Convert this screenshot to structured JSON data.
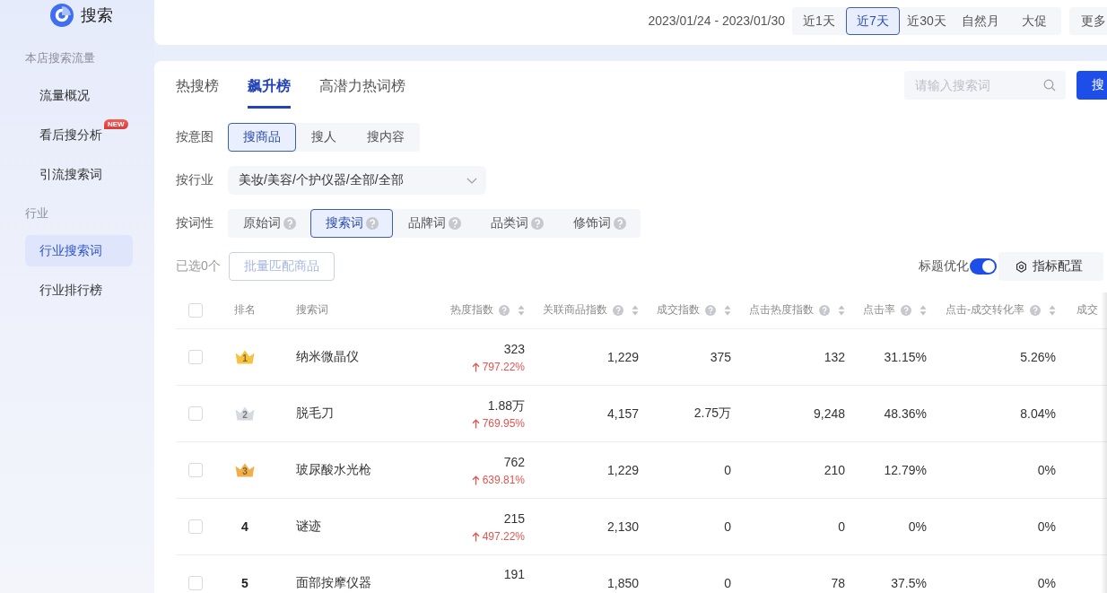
{
  "sidebar": {
    "title": "搜索",
    "sections": [
      {
        "heading": "本店搜索流量",
        "items": [
          {
            "label": "流量概况",
            "selected": false
          },
          {
            "label": "看后搜分析",
            "selected": false,
            "badge": "NEW"
          },
          {
            "label": "引流搜索词",
            "selected": false
          }
        ]
      },
      {
        "heading": "行业",
        "items": [
          {
            "label": "行业搜索词",
            "selected": true
          },
          {
            "label": "行业排行榜",
            "selected": false
          }
        ]
      }
    ]
  },
  "top_bar": {
    "date_range": "2023/01/24 - 2023/01/30",
    "periods": [
      {
        "label": "近1天",
        "selected": false
      },
      {
        "label": "近7天",
        "selected": true
      },
      {
        "label": "近30天",
        "selected": false
      },
      {
        "label": "自然月",
        "selected": false
      },
      {
        "label": "大促",
        "selected": false
      }
    ],
    "more_button": "更多"
  },
  "tabs": [
    {
      "label": "热搜榜",
      "selected": false
    },
    {
      "label": "飙升榜",
      "selected": true
    },
    {
      "label": "高潜力热词榜",
      "selected": false
    }
  ],
  "search": {
    "placeholder": "请输入搜索词",
    "button": "搜"
  },
  "filters": {
    "intent": {
      "label": "按意图",
      "options": [
        {
          "label": "搜商品",
          "selected": true
        },
        {
          "label": "搜人",
          "selected": false
        },
        {
          "label": "搜内容",
          "selected": false
        }
      ]
    },
    "industry": {
      "label": "按行业",
      "value": "美妆/美容/个护仪器/全部/全部"
    },
    "word_type": {
      "label": "按词性",
      "options": [
        {
          "label": "原始词",
          "selected": false
        },
        {
          "label": "搜索词",
          "selected": true
        },
        {
          "label": "品牌词",
          "selected": false
        },
        {
          "label": "品类词",
          "selected": false
        },
        {
          "label": "修饰词",
          "selected": false
        }
      ]
    }
  },
  "selection": {
    "label": "已选0个",
    "batch_button": {
      "label": "批量匹配商品",
      "disabled": true
    }
  },
  "title_optimize": {
    "label": "标题优化",
    "on": true
  },
  "metric_config_button": "指标配置",
  "table": {
    "header_checked": false,
    "columns": [
      {
        "label": "排名",
        "kind": "rank"
      },
      {
        "label": "搜索词",
        "kind": "keyword"
      },
      {
        "label": "热度指数",
        "kind": "metric"
      },
      {
        "label": "关联商品指数",
        "kind": "metric"
      },
      {
        "label": "成交指数",
        "kind": "metric"
      },
      {
        "label": "点击热度指数",
        "kind": "metric"
      },
      {
        "label": "点击率",
        "kind": "metric"
      },
      {
        "label": "点击-成交转化率",
        "kind": "metric"
      },
      {
        "label": "成交",
        "kind": "plain"
      }
    ],
    "rows": [
      {
        "checked": false,
        "rank": {
          "kind": "crown",
          "text": "1",
          "color": "#f5c342"
        },
        "keyword": "纳米微晶仪",
        "metrics": [
          {
            "value": "323",
            "change": "797.22%"
          },
          {
            "value": "1,229"
          },
          {
            "value": "375"
          },
          {
            "value": "132"
          },
          {
            "value": "31.15%"
          },
          {
            "value": "5.26%"
          }
        ]
      },
      {
        "checked": false,
        "rank": {
          "kind": "crown",
          "text": "2",
          "color": "#d6d9de"
        },
        "keyword": "脱毛刀",
        "metrics": [
          {
            "value": "1.88万",
            "change": "769.95%"
          },
          {
            "value": "4,157"
          },
          {
            "value": "2.75万"
          },
          {
            "value": "9,248"
          },
          {
            "value": "48.36%"
          },
          {
            "value": "8.04%"
          }
        ]
      },
      {
        "checked": false,
        "rank": {
          "kind": "crown",
          "text": "3",
          "color": "#efb04c"
        },
        "keyword": "玻尿酸水光枪",
        "metrics": [
          {
            "value": "762",
            "change": "639.81%"
          },
          {
            "value": "1,229"
          },
          {
            "value": "0"
          },
          {
            "value": "210"
          },
          {
            "value": "12.79%"
          },
          {
            "value": "0%"
          }
        ]
      },
      {
        "checked": false,
        "rank": {
          "kind": "plain",
          "text": "4"
        },
        "keyword": "谜迹",
        "metrics": [
          {
            "value": "215",
            "change": "497.22%"
          },
          {
            "value": "2,130"
          },
          {
            "value": "0"
          },
          {
            "value": "0"
          },
          {
            "value": "0%"
          },
          {
            "value": "0%"
          }
        ]
      },
      {
        "checked": false,
        "rank": {
          "kind": "plain",
          "text": "5"
        },
        "keyword": "面部按摩仪器",
        "metrics": [
          {
            "value": "191"
          },
          {
            "value": "1,850"
          },
          {
            "value": "0"
          },
          {
            "value": "78"
          },
          {
            "value": "37.5%"
          },
          {
            "value": "0%"
          }
        ]
      }
    ]
  }
}
